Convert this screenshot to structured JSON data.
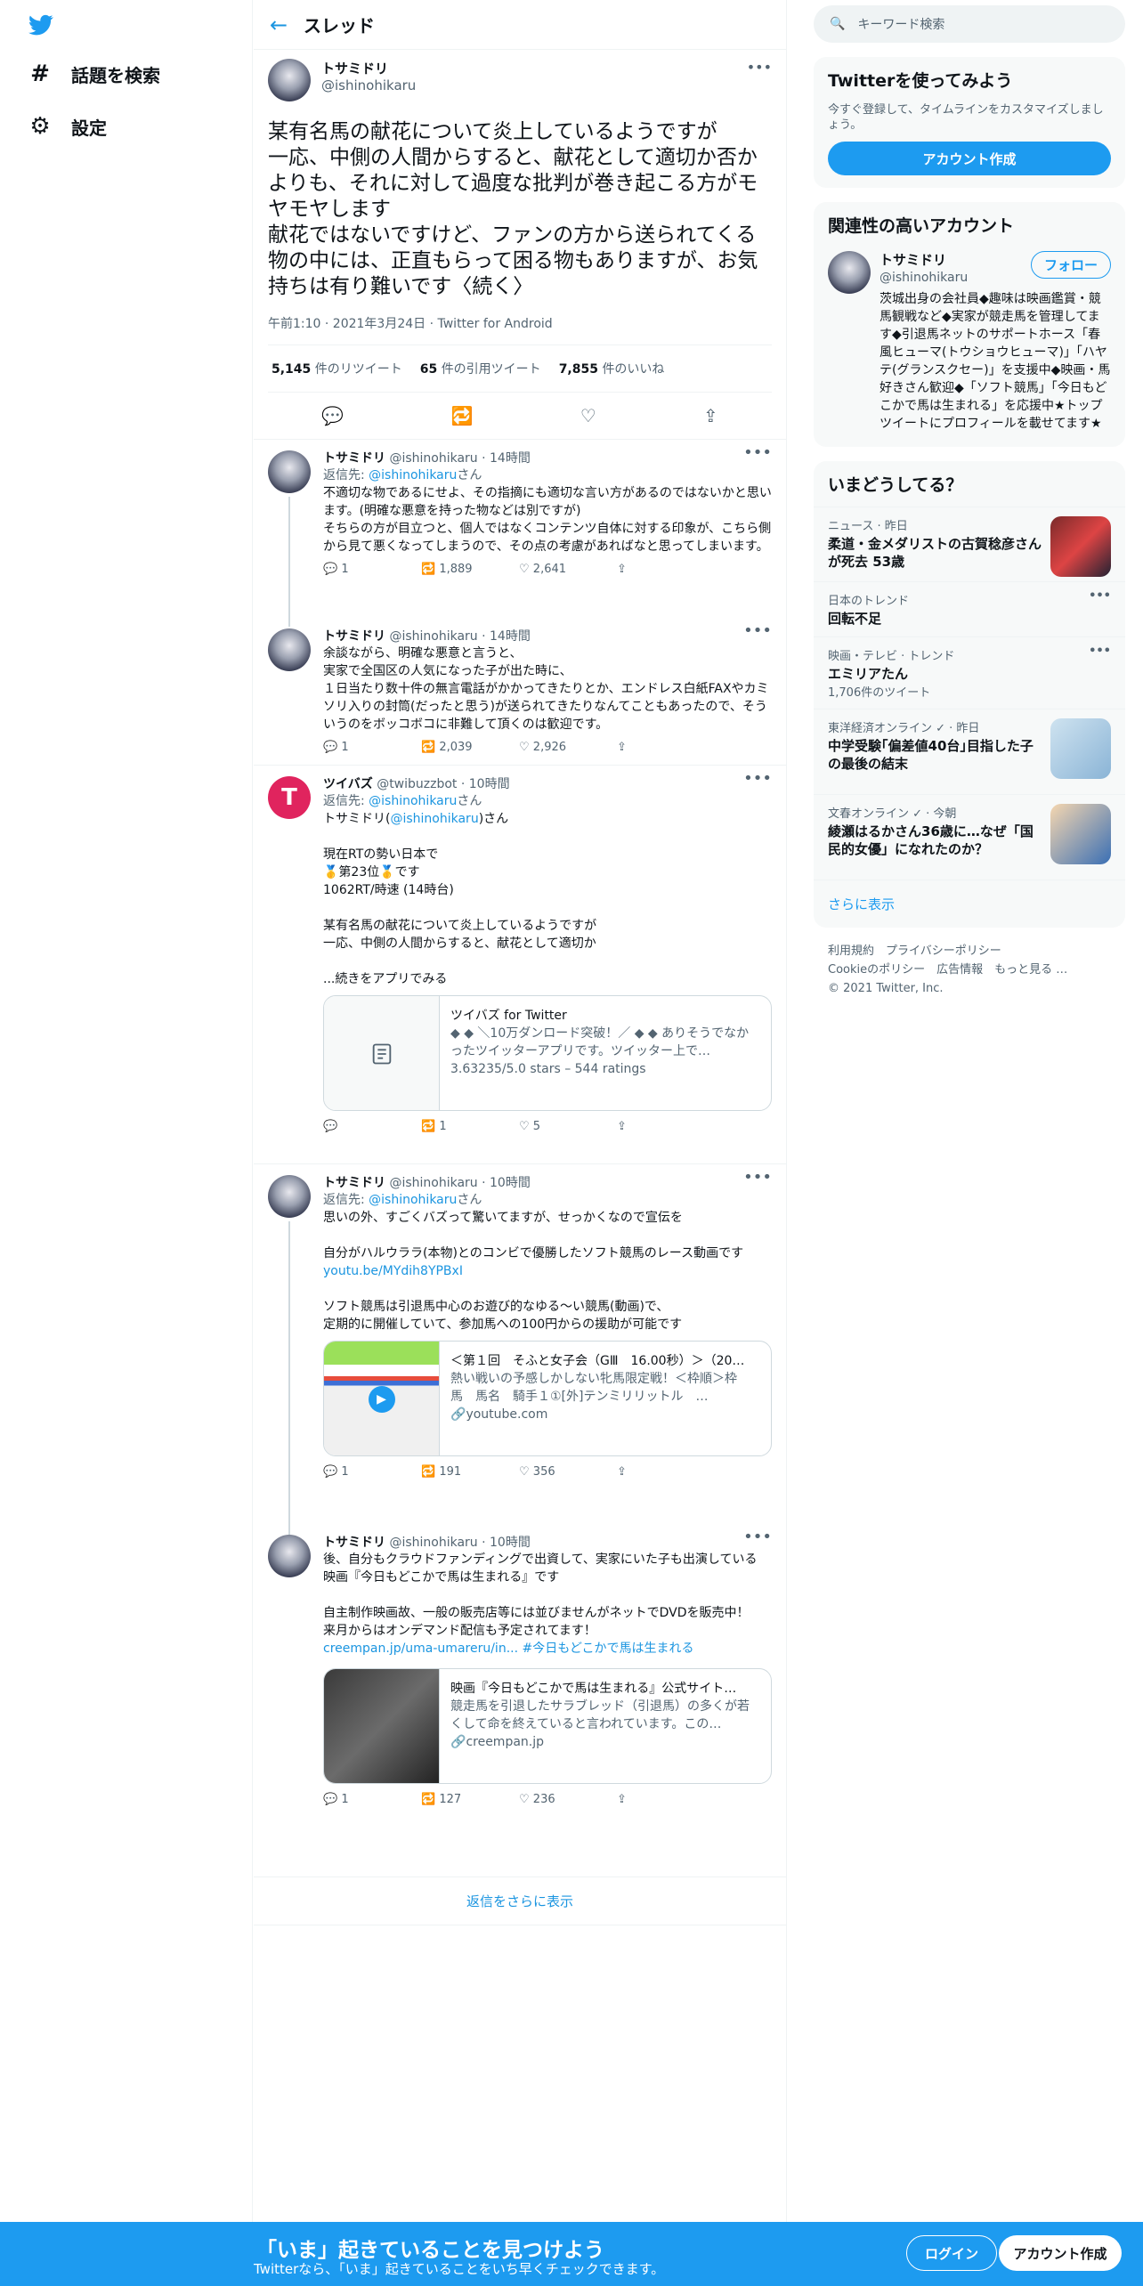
{
  "nav": {
    "explore": "話題を検索",
    "settings": "設定"
  },
  "header": {
    "title": "スレッド"
  },
  "main_tweet": {
    "name": "トサミドリ",
    "handle": "@ishinohikaru",
    "text": "某有名馬の献花について炎上しているようですが\n一応、中側の人間からすると、献花として適切か否かよりも、それに対して過度な批判が巻き起こる方がモヤモヤします\n献花ではないですけど、ファンの方から送られてくる物の中には、正直もらって困る物もありますが、お気持ちは有り難いです〈続く〉",
    "meta": "午前1:10 · 2021年3月24日 · Twitter for Android",
    "retweets_num": "5,145",
    "retweets_label": "件のリツイート",
    "quotes_num": "65",
    "quotes_label": "件の引用ツイート",
    "likes_num": "7,855",
    "likes_label": "件のいいね"
  },
  "replies": [
    {
      "name": "トサミドリ",
      "handle": "@ishinohikaru · 14時間",
      "reply_to_prefix": "返信先: ",
      "reply_to": "@ishinohikaru",
      "reply_to_suffix": "さん",
      "text": "不適切な物であるにせよ、その指摘にも適切な言い方があるのではないかと思います。(明確な悪意を持った物などは別ですが)\nそちらの方が目立つと、個人ではなくコンテンツ自体に対する印象が、こちら側から見て悪くなってしまうので、その点の考慮があればなと思ってしまいます。",
      "replies": "1",
      "retweets": "1,889",
      "likes": "2,641"
    },
    {
      "name": "トサミドリ",
      "handle": "@ishinohikaru · 14時間",
      "text": "余談ながら、明確な悪意と言うと、\n実家で全国区の人気になった子が出た時に、\n１日当たり数十件の無言電話がかかってきたりとか、エンドレス白紙FAXやカミソリ入りの封筒(だったと思う)が送られてきたりなんてこともあったので、そういうのをボッコボコに非難して頂くのは歓迎です。",
      "replies": "1",
      "retweets": "2,039",
      "likes": "2,926"
    },
    {
      "name": "ツイバズ",
      "handle": "@twibuzzbot · 10時間",
      "reply_to_prefix": "返信先: ",
      "reply_to": "@ishinohikaru",
      "reply_to_suffix": "さん",
      "line1_prefix": "トサミドリ(",
      "line1_link": "@ishinohikaru",
      "line1_suffix": ")さん",
      "text": "現在RTの勢い日本で\n🥇第23位🥇です\n1062RT/時速 (14時台)\n\n某有名馬の献花について炎上しているようですが\n一応、中側の人間からすると、献花として適切か\n\n...続きをアプリでみる",
      "card_title": "ツイバズ for Twitter",
      "card_desc": "◆ ◆ ＼10万ダンロード突破！／ ◆ ◆ ありそうでなかったツイッターアプリです。ツイッター上で…",
      "card_meta": "3.63235/5.0 stars – 544 ratings",
      "replies": "",
      "retweets": "1",
      "likes": "5"
    },
    {
      "name": "トサミドリ",
      "handle": "@ishinohikaru · 10時間",
      "reply_to_prefix": "返信先: ",
      "reply_to": "@ishinohikaru",
      "reply_to_suffix": "さん",
      "text1": "思いの外、すごくバズって驚いてますが、せっかくなので宣伝を\n\n自分がハルウララ(本物)とのコンビで優勝したソフト競馬のレース動画です\n",
      "link": "youtu.be/MYdih8YPBxI",
      "text2": "\nソフト競馬は引退馬中心のお遊び的なゆる〜い競馬(動画)で、\n定期的に開催していて、参加馬への100円からの援助が可能です",
      "card_title": "＜第１回　そふと女子会（GⅢ　16.00秒）＞（20…",
      "card_desc": "熱い戦いの予感しかしない牝馬限定戦！＜枠順＞枠　馬　馬名　騎手１①[外]テンミリリットル　…",
      "card_meta": "youtube.com",
      "replies": "1",
      "retweets": "191",
      "likes": "356"
    },
    {
      "name": "トサミドリ",
      "handle": "@ishinohikaru · 10時間",
      "text1": "後、自分もクラウドファンディングで出資して、実家にいた子も出演している\n映画『今日もどこかで馬は生まれる』です\n\n自主制作映画故、一般の販売店等には並びませんがネットでDVDを販売中！\n来月からはオンデマンド配信も予定されてます！\n",
      "link": "creempan.jp/uma-umareru/in...",
      "hashtag": "#今日もどこかで馬は生まれる",
      "card_title": "映画『今日もどこかで馬は生まれる』公式サイト…",
      "card_desc": "競走馬を引退したサラブレッド（引退馬）の多くが若くして命を終えていると言われています。この…",
      "card_meta": "creempan.jp",
      "replies": "1",
      "retweets": "127",
      "likes": "236"
    }
  ],
  "more_replies": "返信をさらに表示",
  "search": {
    "placeholder": "キーワード検索"
  },
  "signup_panel": {
    "title": "Twitterを使ってみよう",
    "desc": "今すぐ登録して、タイムラインをカスタマイズしましょう。",
    "button": "アカウント作成"
  },
  "related": {
    "title": "関連性の高いアカウント",
    "name": "トサミドリ",
    "handle": "@ishinohikaru",
    "follow": "フォロー",
    "bio": "茨城出身の会社員◆趣味は映画鑑賞・競馬観戦など◆実家が競走馬を管理してます◆引退馬ネットのサポートホース「春風ヒューマ(トウショウヒューマ)」「ハヤテ(グランスクセー)」を支援中◆映画・馬好きさん歓迎◆「ソフト競馬」「今日もどこかで馬は生まれる」を応援中★トップツイートにプロフィールを載せてます★"
  },
  "trends": {
    "title": "いまどうしてる？",
    "items": [
      {
        "cat": "ニュース · 昨日",
        "title": "柔道・金メダリストの古賀稔彦さんが死去 53歳",
        "img": true
      },
      {
        "cat": "日本のトレンド",
        "title": "回転不足",
        "dots": true
      },
      {
        "cat": "映画・テレビ · トレンド",
        "title": "エミリアたん",
        "count": "1,706件のツイート",
        "dots": true
      },
      {
        "cat": "東洋経済オンライン ✓ · 昨日",
        "title": "中学受験｢偏差値40台｣目指した子の最後の結末",
        "img": true
      },
      {
        "cat": "文春オンライン ✓ · 今朝",
        "title": "綾瀬はるかさん36歳に…なぜ「国民的女優」になれたのか？",
        "img": true
      }
    ],
    "show_more": "さらに表示"
  },
  "footer": {
    "l1": "利用規約",
    "l2": "プライバシーポリシー",
    "l3": "Cookieのポリシー",
    "l4": "広告情報",
    "l5": "もっと見る …",
    "copy": "© 2021 Twitter, Inc."
  },
  "bottom_bar": {
    "headline": "「いま」起きていることを見つけよう",
    "sub": "Twitterなら、「いま」起きていることをいち早くチェックできます。",
    "login": "ログイン",
    "signup": "アカウント作成"
  },
  "colors": {
    "accent": "#1d9bf0",
    "link": "#1b95e0"
  }
}
